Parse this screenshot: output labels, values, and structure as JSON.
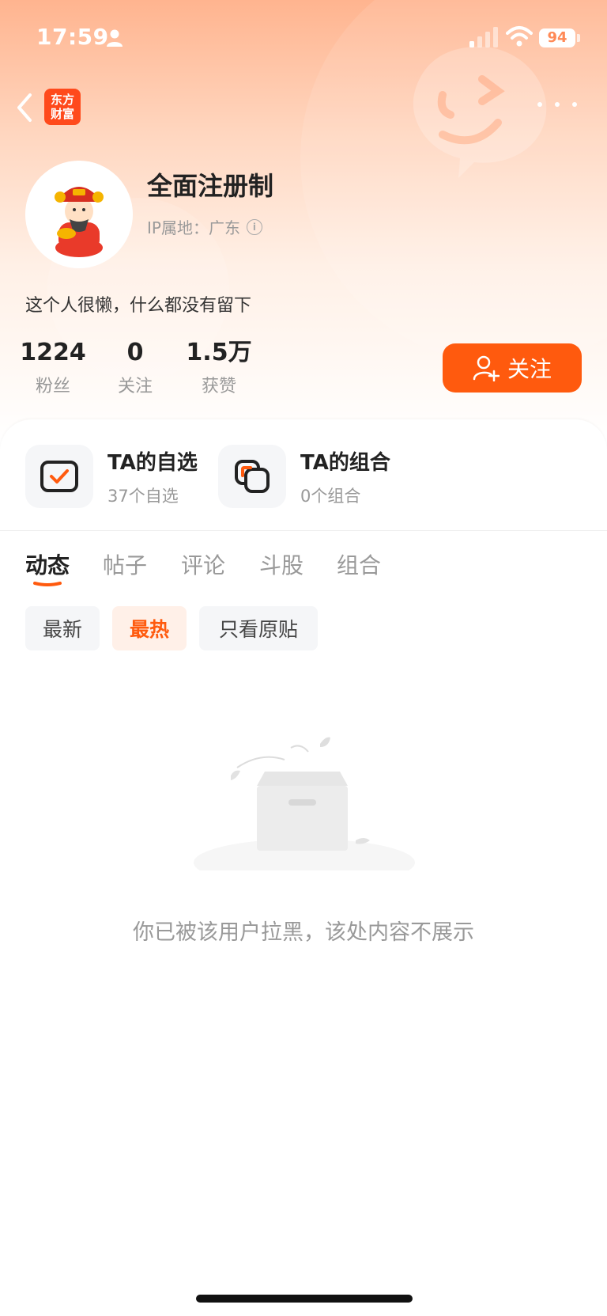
{
  "status_bar": {
    "time": "17:59",
    "battery": "94"
  },
  "nav": {
    "logo_line1": "东方",
    "logo_line2": "财富"
  },
  "profile": {
    "username": "全面注册制",
    "ip_location": "IP属地：广东",
    "bio": "这个人很懒，什么都没有留下"
  },
  "stats": [
    {
      "value": "1224",
      "label": "粉丝"
    },
    {
      "value": "0",
      "label": "关注"
    },
    {
      "value": "1.5万",
      "label": "获赞"
    }
  ],
  "follow_button": {
    "label": "关注"
  },
  "quick_links": [
    {
      "title": "TA的自选",
      "subtitle": "37个自选",
      "icon": "checklist-icon"
    },
    {
      "title": "TA的组合",
      "subtitle": "0个组合",
      "icon": "portfolio-icon"
    }
  ],
  "tabs": [
    {
      "label": "动态",
      "active": true
    },
    {
      "label": "帖子",
      "active": false
    },
    {
      "label": "评论",
      "active": false
    },
    {
      "label": "斗股",
      "active": false
    },
    {
      "label": "组合",
      "active": false
    }
  ],
  "filters": [
    {
      "label": "最新",
      "active": false
    },
    {
      "label": "最热",
      "active": true
    },
    {
      "label": "只看原贴",
      "active": false
    }
  ],
  "empty_state": {
    "message": "你已被该用户拉黑，该处内容不展示"
  },
  "colors": {
    "accent": "#ff5a0e",
    "header_gradient_top": "#ffb48f"
  }
}
